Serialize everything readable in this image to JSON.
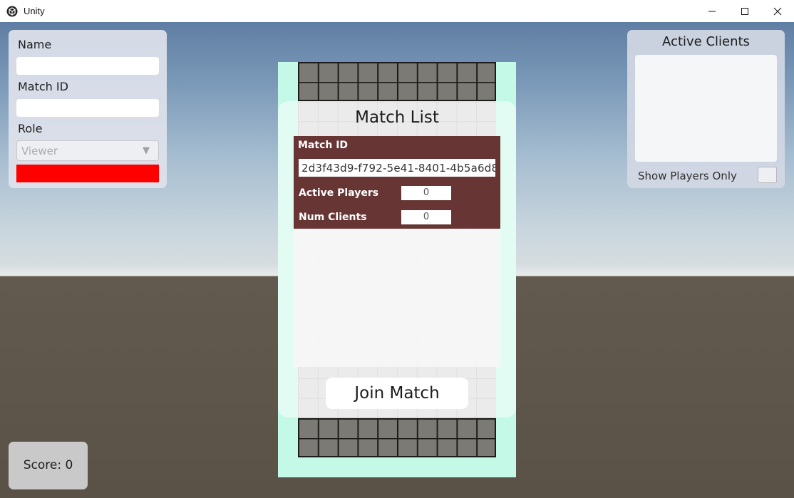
{
  "window": {
    "title": "Unity",
    "icon": "unity-logo-icon",
    "controls": [
      "minimize-icon",
      "maximize-icon",
      "close-icon"
    ]
  },
  "left_panel": {
    "name_label": "Name",
    "name_value": "",
    "match_id_label": "Match ID",
    "match_id_value": "",
    "role_label": "Role",
    "role_selected": "Viewer",
    "color_swatch": "#ff0000"
  },
  "right_panel": {
    "title": "Active Clients",
    "clients": [],
    "toggle_label": "Show Players Only",
    "toggle_checked": false
  },
  "match_list": {
    "title": "Match List",
    "matches": [
      {
        "match_id_label": "Match ID",
        "match_id": "2d3f43d9-f792-5e41-8401-4b5a6d8",
        "active_players_label": "Active Players",
        "active_players": "0",
        "num_clients_label": "Num Clients",
        "num_clients": "0"
      }
    ],
    "join_button": "Join Match"
  },
  "score": {
    "text": "Score: 0"
  },
  "colors": {
    "board_frame": "#c4f9e7",
    "match_card": "#663534",
    "dark_block": "#7b7a74"
  }
}
